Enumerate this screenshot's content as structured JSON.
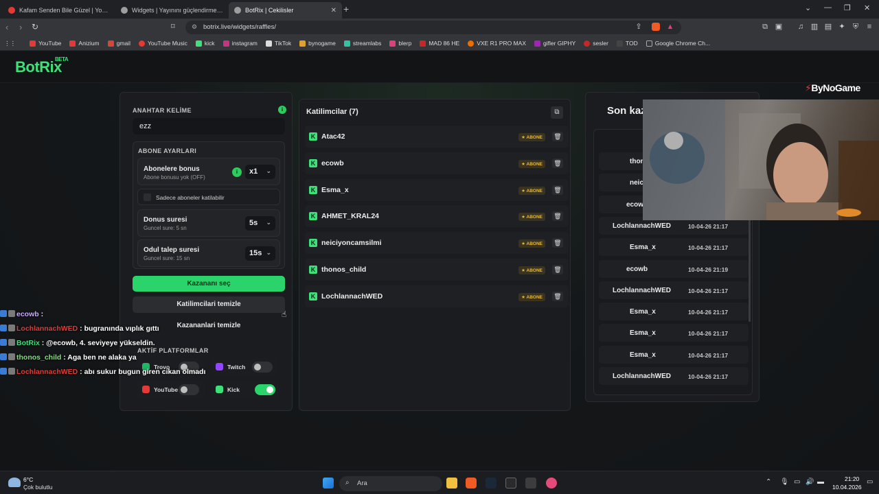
{
  "browser": {
    "tabs": [
      {
        "label": "Kafam Senden Bile Güzel | YouTu",
        "fav_color": "#e53935",
        "active": false
      },
      {
        "label": "Widgets | Yayınını güçlendirmek için",
        "fav_color": "#bdbdbd",
        "active": false
      },
      {
        "label": "BotRix | Cekilisler",
        "fav_color": "#bdbdbd",
        "active": true
      }
    ],
    "new_tab": "+",
    "url": "botrix.live/widgets/raffles/",
    "bookmarks": [
      {
        "label": "YouTube",
        "color": "#e53935"
      },
      {
        "label": "Anizium",
        "color": "#e53935"
      },
      {
        "label": "gmail",
        "color": "#d44638"
      },
      {
        "label": "YouTube Music",
        "color": "#e53935"
      },
      {
        "label": "kick",
        "color": "#3ee07a"
      },
      {
        "label": "instagram",
        "color": "#c13584"
      },
      {
        "label": "TikTok",
        "color": "#dddddd"
      },
      {
        "label": "bynogame",
        "color": "#e0a030"
      },
      {
        "label": "streamlabs",
        "color": "#31c3a2"
      },
      {
        "label": "blerp",
        "color": "#e0407a"
      },
      {
        "label": "MAD 86 HE",
        "color": "#c62828"
      },
      {
        "label": "VXE R1 PRO MAX",
        "color": "#ef6c00"
      },
      {
        "label": "gifler GIPHY",
        "color": "#9c27b0"
      },
      {
        "label": "sesler",
        "color": "#c62828"
      },
      {
        "label": "TOD",
        "color": "#444444"
      },
      {
        "label": "Google Chrome Ch...",
        "color": "#777777"
      }
    ]
  },
  "app": {
    "logo": "BotRix",
    "beta": "BETA",
    "sponsor": "ByNoGame"
  },
  "settings": {
    "keyword_label": "ANAHTAR KELİME",
    "keyword_value": "ezz",
    "sub_section": "ABONE AYARLARI",
    "sub_bonus_title": "Abonelere bonus",
    "sub_bonus_sub": "Abone bonusu yok (OFF)",
    "sub_bonus_value": "x1",
    "only_subs": "Sadece aboneler katilabilir",
    "donus_title": "Donus suresi",
    "donus_sub": "Guncel sure: 5 sn",
    "donus_value": "5s",
    "odul_title": "Odul talep suresi",
    "odul_sub": "Guncel sure: 15 sn",
    "odul_value": "15s",
    "pick_winner": "Kazananı seç",
    "clear_participants": "Katilimcilari temizle",
    "clear_winners": "Kazananlari temizle",
    "platforms_label": "AKTİF PLATFORMLAR",
    "platforms": [
      {
        "name": "Trovo",
        "color": "#1fb866",
        "on": false
      },
      {
        "name": "Twitch",
        "color": "#9146ff",
        "on": false
      },
      {
        "name": "YouTube",
        "color": "#e53935",
        "on": false
      },
      {
        "name": "Kick",
        "color": "#3ee07a",
        "on": true
      }
    ]
  },
  "participants": {
    "title": "Katilimcilar (7)",
    "badge": "ABONE",
    "items": [
      "Atac42",
      "ecowb",
      "Esma_x",
      "AHMET_KRAL24",
      "neiciyoncamsilmi",
      "thonos_child",
      "LochlannachWED"
    ]
  },
  "winners": {
    "title": "Son kaz",
    "items": [
      {
        "name": "thonos",
        "date": ""
      },
      {
        "name": "neiciyosun",
        "date": ""
      },
      {
        "name": "ecow",
        "date": ""
      },
      {
        "name": "LochlannachWED",
        "date": "10-04-26 21:17"
      },
      {
        "name": "Esma_x",
        "date": "10-04-26 21:17"
      },
      {
        "name": "ecowb",
        "date": "10-04-26 21:19"
      },
      {
        "name": "LochlannachWED",
        "date": "10-04-26 21:17"
      },
      {
        "name": "Esma_x",
        "date": "10-04-26 21:17"
      },
      {
        "name": "Esma_x",
        "date": "10-04-26 21:17"
      },
      {
        "name": "Esma_x",
        "date": "10-04-26 21:17"
      },
      {
        "name": "LochlannachWED",
        "date": "10-04-26 21:17"
      }
    ]
  },
  "chat": [
    {
      "user": "ecowb",
      "user_color": "#c8a8ff",
      "text": " :"
    },
    {
      "user": "LochlannachWED",
      "user_color": "#e53935",
      "text": " : bugranında vıplık gıttı"
    },
    {
      "user": "BotRix",
      "user_color": "#3ee07a",
      "text": " : @ecowb, 4. seviyeye yükseldin."
    },
    {
      "user": "thonos_child",
      "user_color": "#7ee07a",
      "text": " : Aga ben ne alaka ya"
    },
    {
      "user": "LochlannachWED",
      "user_color": "#e53935",
      "text": " : abı sukur bugun giren cikan olmadı"
    }
  ],
  "taskbar": {
    "weather_temp": "6°C",
    "weather_desc": "Çok bulutlu",
    "search": "Ara",
    "time": "21:20",
    "date": "10.04.2026"
  }
}
